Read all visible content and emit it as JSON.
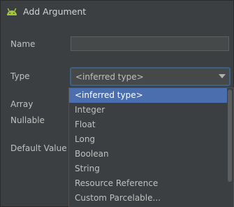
{
  "window": {
    "title": "Add Argument",
    "icon": "android-icon"
  },
  "form": {
    "name_label": "Name",
    "name_value": "",
    "type_label": "Type",
    "type_value": "<inferred type>",
    "array_label": "Array",
    "nullable_label": "Nullable",
    "default_value_label": "Default Value"
  },
  "dropdown": {
    "options": [
      "<inferred type>",
      "Integer",
      "Float",
      "Long",
      "Boolean",
      "String",
      "Resource Reference",
      "Custom Parcelable..."
    ],
    "selected_index": 0
  },
  "colors": {
    "background": "#3c3f41",
    "selection": "#4b6eaf",
    "focus_border": "#3d6185",
    "android_green": "#a4c639"
  }
}
